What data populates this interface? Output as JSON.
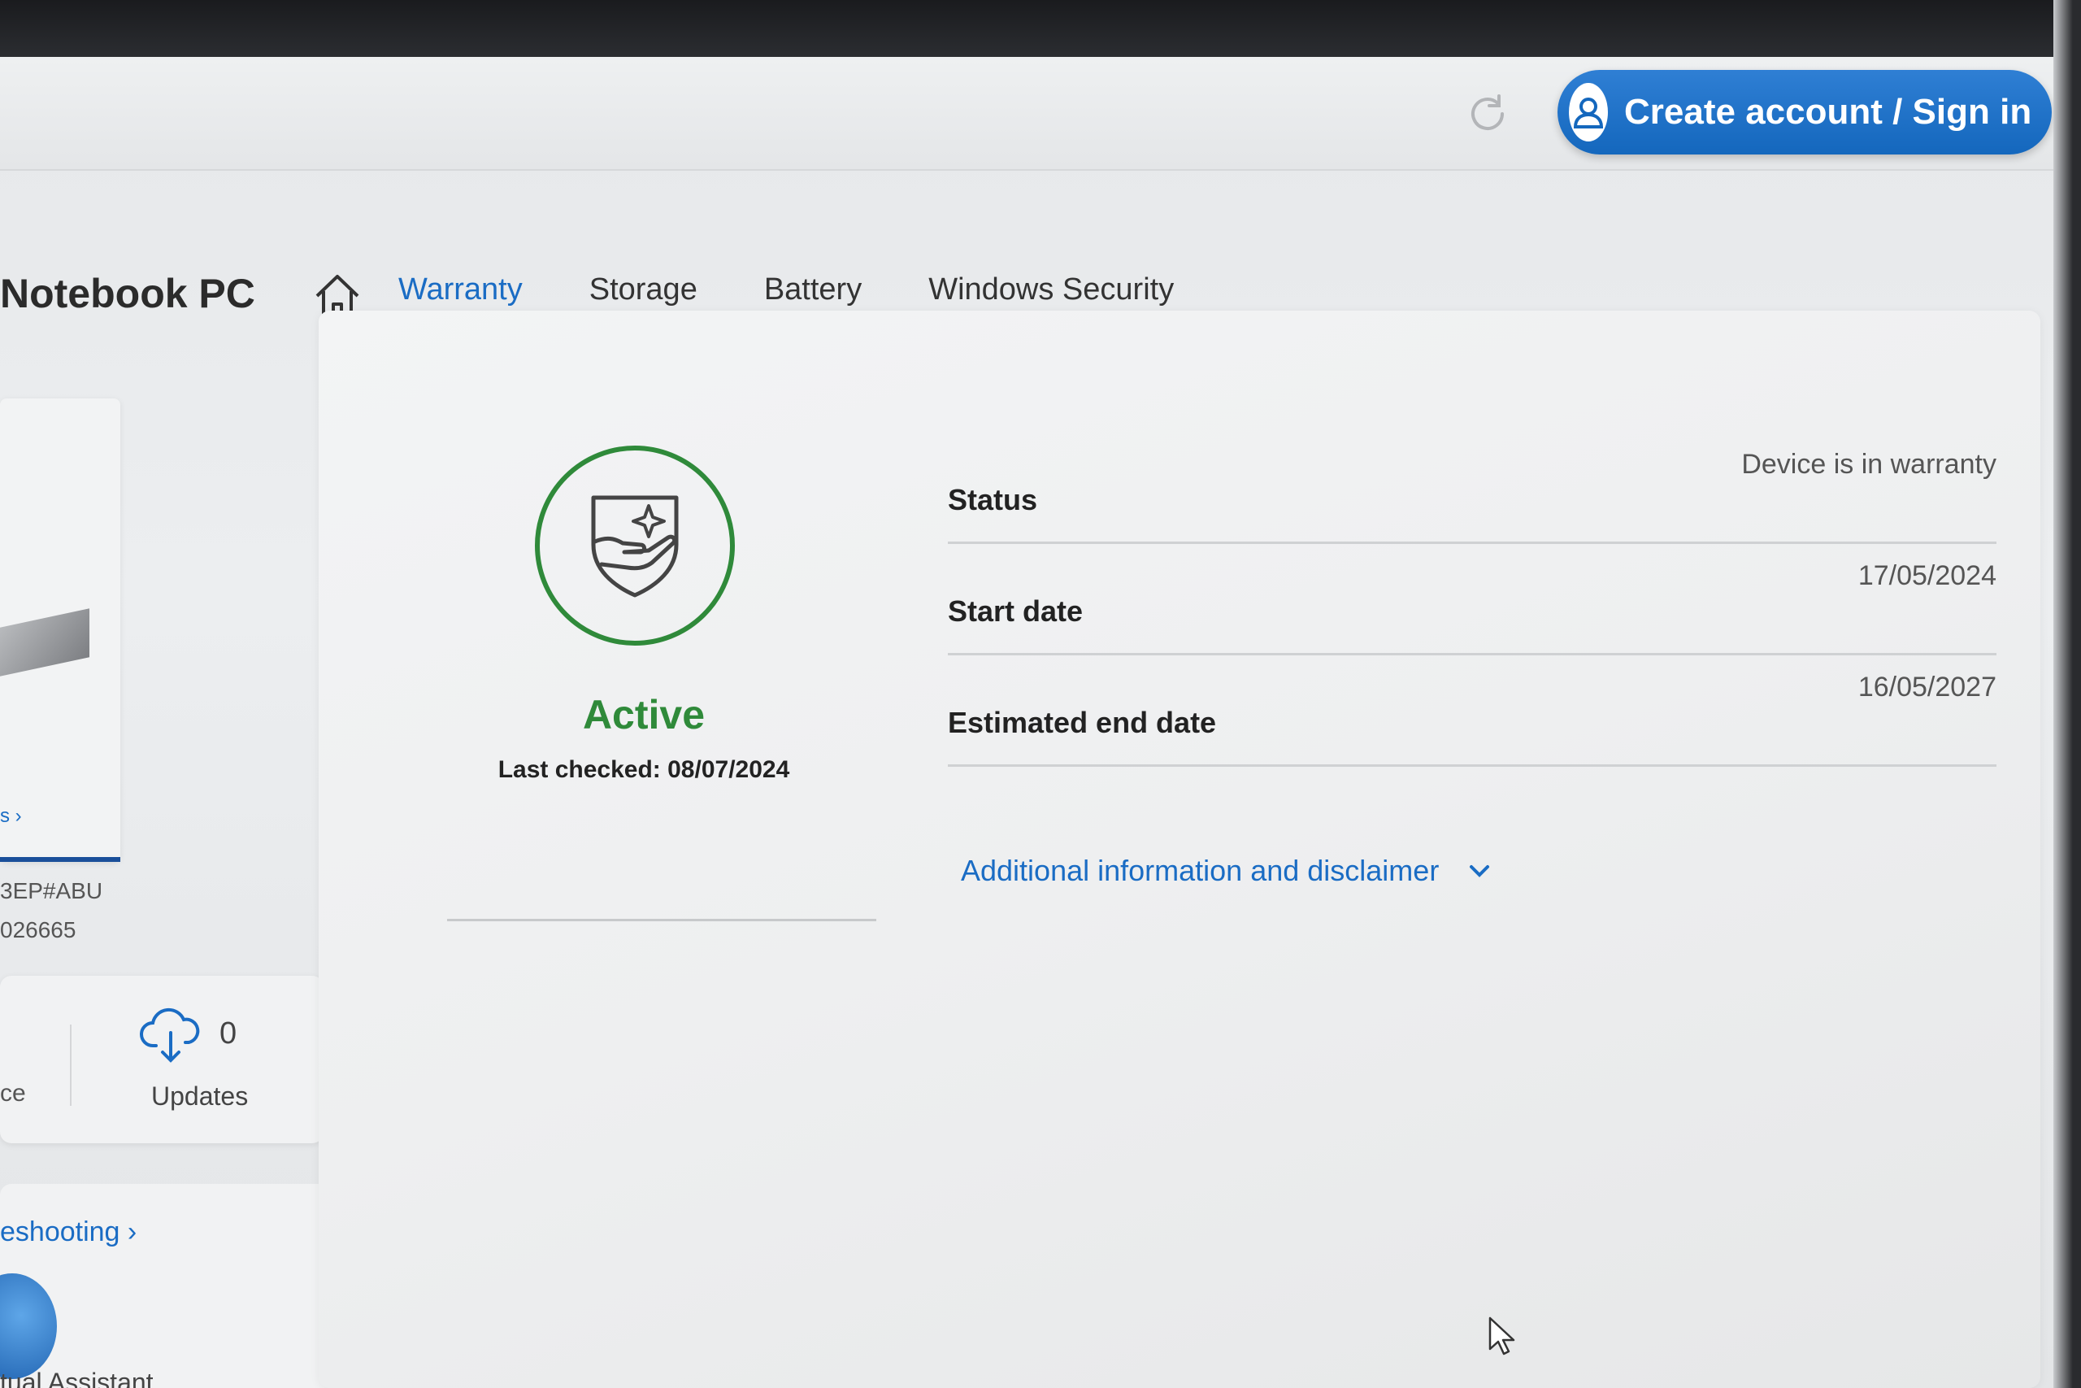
{
  "header": {
    "signin_label": "Create account / Sign in"
  },
  "product": {
    "title": "Notebook PC"
  },
  "nav": {
    "tabs": [
      {
        "label": "Warranty",
        "active": true
      },
      {
        "label": "Storage",
        "active": false
      },
      {
        "label": "Battery",
        "active": false
      },
      {
        "label": "Windows Security",
        "active": false
      }
    ]
  },
  "sidebar": {
    "details_link": "s ›",
    "product_number": "3EP#ABU",
    "serial_number": "026665",
    "stat_stub_label": "ce",
    "updates_count": "0",
    "updates_label": "Updates",
    "troubleshooting_link": "eshooting ›",
    "assistant_label": "tual Assistant"
  },
  "warranty": {
    "status_word": "Active",
    "last_checked": "Last checked: 08/07/2024",
    "rows": [
      {
        "label": "Status",
        "value": "Device is in warranty"
      },
      {
        "label": "Start date",
        "value": "17/05/2024"
      },
      {
        "label": "Estimated end date",
        "value": "16/05/2027"
      }
    ],
    "additional_link": "Additional information and disclaimer"
  },
  "colors": {
    "accent_blue": "#1a6cc4",
    "active_green": "#2f8a3a"
  },
  "icons": [
    "refresh-icon",
    "user-icon",
    "chevron-down-icon",
    "home-icon",
    "shield-hand-icon",
    "cloud-download-icon",
    "cursor-icon"
  ]
}
